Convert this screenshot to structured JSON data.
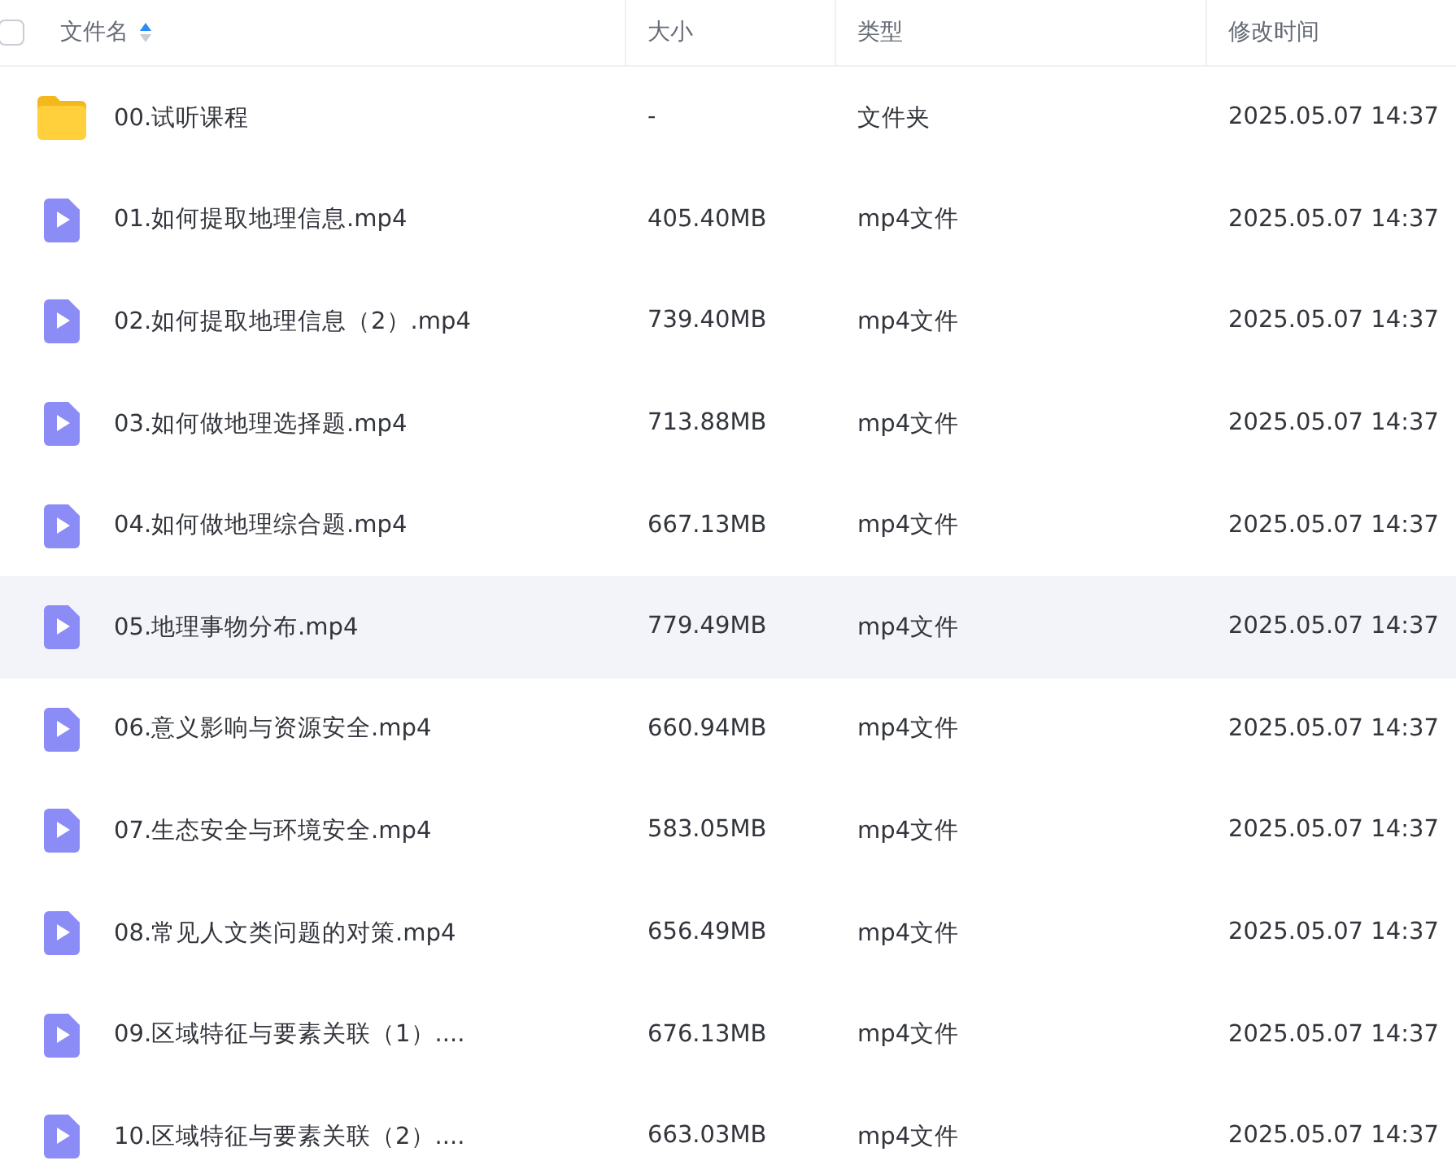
{
  "header": {
    "select_all": {
      "checked": false
    },
    "columns": [
      {
        "label": "文件名",
        "sorted_ascending": true
      },
      {
        "label": "大小"
      },
      {
        "label": "类型"
      },
      {
        "label": "修改时间"
      }
    ]
  },
  "rows": [
    {
      "kind": "folder",
      "name": "00.试听课程",
      "size": "-",
      "type": "文件夹",
      "modified": "2025.05.07 14:37",
      "highlighted": false
    },
    {
      "kind": "video",
      "name": "01.如何提取地理信息.mp4",
      "size": "405.40MB",
      "type": "mp4文件",
      "modified": "2025.05.07 14:37",
      "highlighted": false
    },
    {
      "kind": "video",
      "name": "02.如何提取地理信息（2）.mp4",
      "size": "739.40MB",
      "type": "mp4文件",
      "modified": "2025.05.07 14:37",
      "highlighted": false
    },
    {
      "kind": "video",
      "name": "03.如何做地理选择题.mp4",
      "size": "713.88MB",
      "type": "mp4文件",
      "modified": "2025.05.07 14:37",
      "highlighted": false
    },
    {
      "kind": "video",
      "name": "04.如何做地理综合题.mp4",
      "size": "667.13MB",
      "type": "mp4文件",
      "modified": "2025.05.07 14:37",
      "highlighted": false
    },
    {
      "kind": "video",
      "name": "05.地理事物分布.mp4",
      "size": "779.49MB",
      "type": "mp4文件",
      "modified": "2025.05.07 14:37",
      "highlighted": true
    },
    {
      "kind": "video",
      "name": "06.意义影响与资源安全.mp4",
      "size": "660.94MB",
      "type": "mp4文件",
      "modified": "2025.05.07 14:37",
      "highlighted": false
    },
    {
      "kind": "video",
      "name": "07.生态安全与环境安全.mp4",
      "size": "583.05MB",
      "type": "mp4文件",
      "modified": "2025.05.07 14:37",
      "highlighted": false
    },
    {
      "kind": "video",
      "name": "08.常见人文类问题的对策.mp4",
      "size": "656.49MB",
      "type": "mp4文件",
      "modified": "2025.05.07 14:37",
      "highlighted": false
    },
    {
      "kind": "video",
      "name": "09.区域特征与要素关联（1）....",
      "size": "676.13MB",
      "type": "mp4文件",
      "modified": "2025.05.07 14:37",
      "highlighted": false
    },
    {
      "kind": "video",
      "name": "10.区域特征与要素关联（2）....",
      "size": "663.03MB",
      "type": "mp4文件",
      "modified": "2025.05.07 14:37",
      "highlighted": false
    }
  ]
}
